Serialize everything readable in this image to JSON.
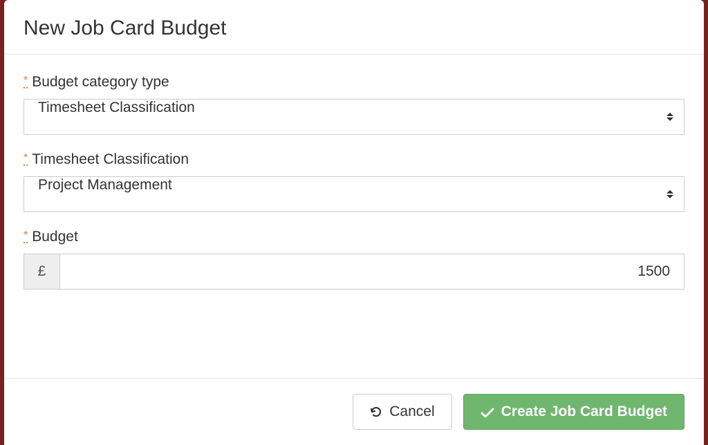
{
  "modal": {
    "title": "New Job Card Budget"
  },
  "form": {
    "category_type": {
      "label": "Budget category type",
      "value": "Timesheet Classification"
    },
    "classification": {
      "label": "Timesheet Classification",
      "value": "Project Management"
    },
    "budget": {
      "label": "Budget",
      "currency_symbol": "£",
      "value": "1500"
    }
  },
  "footer": {
    "cancel_label": "Cancel",
    "submit_label": "Create Job Card Budget"
  }
}
